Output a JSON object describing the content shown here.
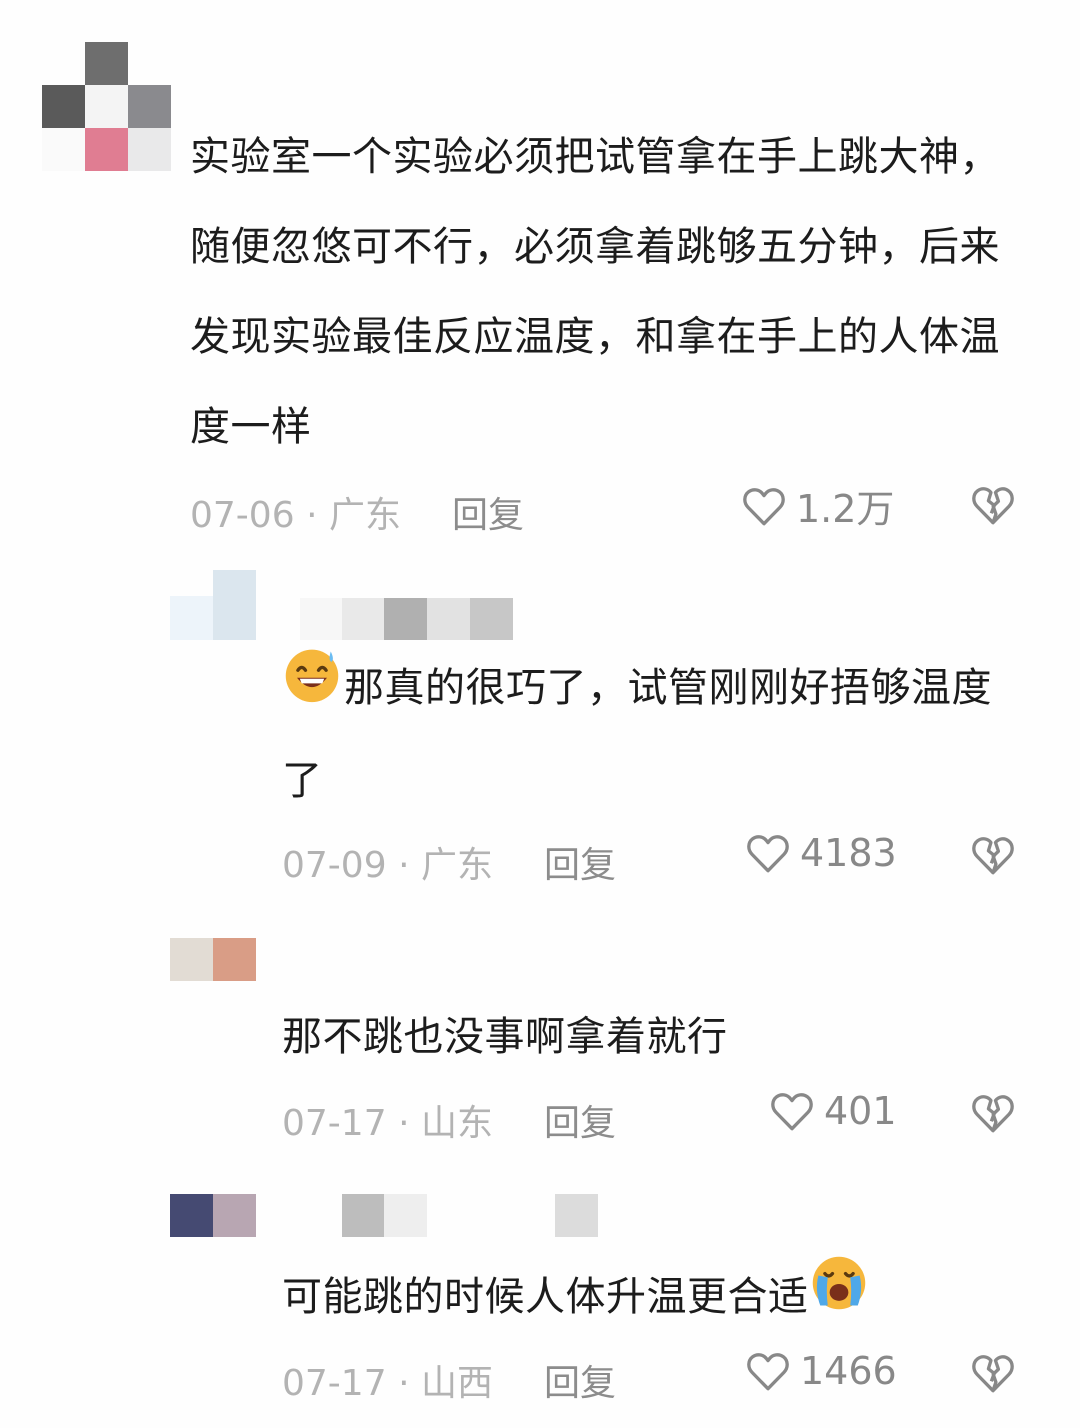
{
  "comments": [
    {
      "text": "实验室一个实验必须把试管拿在手上跳大神，随便忽悠可不行，必须拿着跳够五分钟，后来发现实验最佳反应温度，和拿在手上的人体温度一样",
      "date": "07-06",
      "location": "广东",
      "reply_label": "回复",
      "likes": "1.2万"
    },
    {
      "emoji": "grinning-sweat-face",
      "text": "那真的很巧了，试管刚刚好捂够温度了",
      "date": "07-09",
      "location": "广东",
      "reply_label": "回复",
      "likes": "4183"
    },
    {
      "text": "那不跳也没事啊拿着就行",
      "date": "07-17",
      "location": "山东",
      "reply_label": "回复",
      "likes": "401"
    },
    {
      "text": "可能跳的时候人体升温更合适",
      "emoji_after": "loudly-crying-face",
      "date": "07-17",
      "location": "山西",
      "reply_label": "回复",
      "likes": "1466"
    }
  ],
  "meta_separator": "·",
  "icons": {
    "like": "heart-outline-icon",
    "dislike": "broken-heart-icon"
  },
  "colors": {
    "text": "#1c1c1c",
    "meta": "#b3b3b3",
    "icon": "#888888"
  }
}
